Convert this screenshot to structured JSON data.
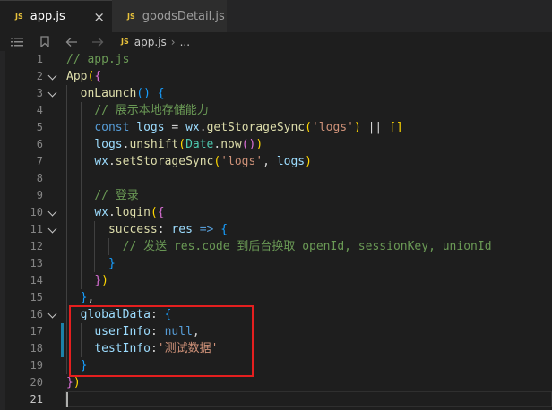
{
  "tabs": [
    {
      "icon": "JS",
      "label": "app.js",
      "close": "×",
      "active": true
    },
    {
      "icon": "JS",
      "label": "goodsDetail.js",
      "active": false
    }
  ],
  "breadcrumb": {
    "icon": "JS",
    "file": "app.js",
    "separator": "›",
    "more": "..."
  },
  "editor": {
    "current_line": 21,
    "highlight_color": "#e51f1f",
    "lines": [
      {
        "n": "1",
        "tokens": [
          [
            "// app.js",
            "c-comment"
          ]
        ]
      },
      {
        "n": "2",
        "fold": true,
        "tokens": [
          [
            "App",
            "c-fn"
          ],
          [
            "(",
            "c-b1"
          ],
          [
            "{",
            "c-b2"
          ]
        ]
      },
      {
        "n": "3",
        "fold": true,
        "tokens": [
          [
            "  ",
            ""
          ],
          [
            "onLaunch",
            "c-fn"
          ],
          [
            "() ",
            "c-b3"
          ],
          [
            "{",
            "c-b3"
          ]
        ]
      },
      {
        "n": "4",
        "tokens": [
          [
            "    ",
            ""
          ],
          [
            "// 展示本地存储能力",
            "c-comment"
          ]
        ]
      },
      {
        "n": "5",
        "tokens": [
          [
            "    ",
            ""
          ],
          [
            "const",
            "c-kw"
          ],
          [
            " ",
            ""
          ],
          [
            "logs",
            "c-var"
          ],
          [
            " = ",
            "c-op"
          ],
          [
            "wx",
            "c-var"
          ],
          [
            ".",
            ""
          ],
          [
            "getStorageSync",
            "c-fn"
          ],
          [
            "(",
            "c-b1"
          ],
          [
            "'logs'",
            "c-str"
          ],
          [
            ")",
            "c-b1"
          ],
          [
            " || ",
            "c-op"
          ],
          [
            "[]",
            "c-b1"
          ]
        ]
      },
      {
        "n": "6",
        "tokens": [
          [
            "    ",
            ""
          ],
          [
            "logs",
            "c-var"
          ],
          [
            ".",
            ""
          ],
          [
            "unshift",
            "c-fn"
          ],
          [
            "(",
            "c-b1"
          ],
          [
            "Date",
            "c-cls"
          ],
          [
            ".",
            ""
          ],
          [
            "now",
            "c-fn"
          ],
          [
            "()",
            "c-b2"
          ],
          [
            ")",
            "c-b1"
          ]
        ]
      },
      {
        "n": "7",
        "tokens": [
          [
            "    ",
            ""
          ],
          [
            "wx",
            "c-var"
          ],
          [
            ".",
            ""
          ],
          [
            "setStorageSync",
            "c-fn"
          ],
          [
            "(",
            "c-b1"
          ],
          [
            "'logs'",
            "c-str"
          ],
          [
            ", ",
            ""
          ],
          [
            "logs",
            "c-var"
          ],
          [
            ")",
            "c-b1"
          ]
        ]
      },
      {
        "n": "8",
        "tokens": []
      },
      {
        "n": "9",
        "tokens": [
          [
            "    ",
            ""
          ],
          [
            "// 登录",
            "c-comment"
          ]
        ]
      },
      {
        "n": "10",
        "fold": true,
        "tokens": [
          [
            "    ",
            ""
          ],
          [
            "wx",
            "c-var"
          ],
          [
            ".",
            ""
          ],
          [
            "login",
            "c-fn"
          ],
          [
            "(",
            "c-b1"
          ],
          [
            "{",
            "c-b2"
          ]
        ]
      },
      {
        "n": "11",
        "fold": true,
        "tokens": [
          [
            "      ",
            ""
          ],
          [
            "success",
            "c-fn"
          ],
          [
            ": ",
            ""
          ],
          [
            "res",
            "c-var"
          ],
          [
            " => ",
            "c-kw"
          ],
          [
            "{",
            "c-b3"
          ]
        ]
      },
      {
        "n": "12",
        "tokens": [
          [
            "        ",
            ""
          ],
          [
            "// 发送 res.code 到后台换取 openId, sessionKey, unionId",
            "c-comment"
          ]
        ]
      },
      {
        "n": "13",
        "tokens": [
          [
            "      ",
            ""
          ],
          [
            "}",
            "c-b3"
          ]
        ]
      },
      {
        "n": "14",
        "tokens": [
          [
            "    ",
            ""
          ],
          [
            "}",
            "c-b2"
          ],
          [
            ")",
            "c-b1"
          ]
        ]
      },
      {
        "n": "15",
        "tokens": [
          [
            "  ",
            ""
          ],
          [
            "}",
            "c-b3"
          ],
          [
            ",",
            ""
          ]
        ]
      },
      {
        "n": "16",
        "fold": true,
        "tokens": [
          [
            "  ",
            ""
          ],
          [
            "globalData",
            "c-prop"
          ],
          [
            ": ",
            ""
          ],
          [
            "{",
            "c-b3"
          ]
        ]
      },
      {
        "n": "17",
        "tokens": [
          [
            "    ",
            ""
          ],
          [
            "userInfo",
            "c-prop"
          ],
          [
            ": ",
            ""
          ],
          [
            "null",
            "c-kw"
          ],
          [
            ",",
            ""
          ]
        ]
      },
      {
        "n": "18",
        "tokens": [
          [
            "    ",
            ""
          ],
          [
            "testInfo",
            "c-prop"
          ],
          [
            ":",
            ""
          ],
          [
            "'测试数据'",
            "c-str"
          ]
        ]
      },
      {
        "n": "19",
        "tokens": [
          [
            "  ",
            ""
          ],
          [
            "}",
            "c-b3"
          ]
        ]
      },
      {
        "n": "20",
        "tokens": [
          [
            "}",
            "c-b2"
          ],
          [
            ")",
            "c-b1"
          ]
        ]
      },
      {
        "n": "21",
        "tokens": []
      }
    ]
  }
}
